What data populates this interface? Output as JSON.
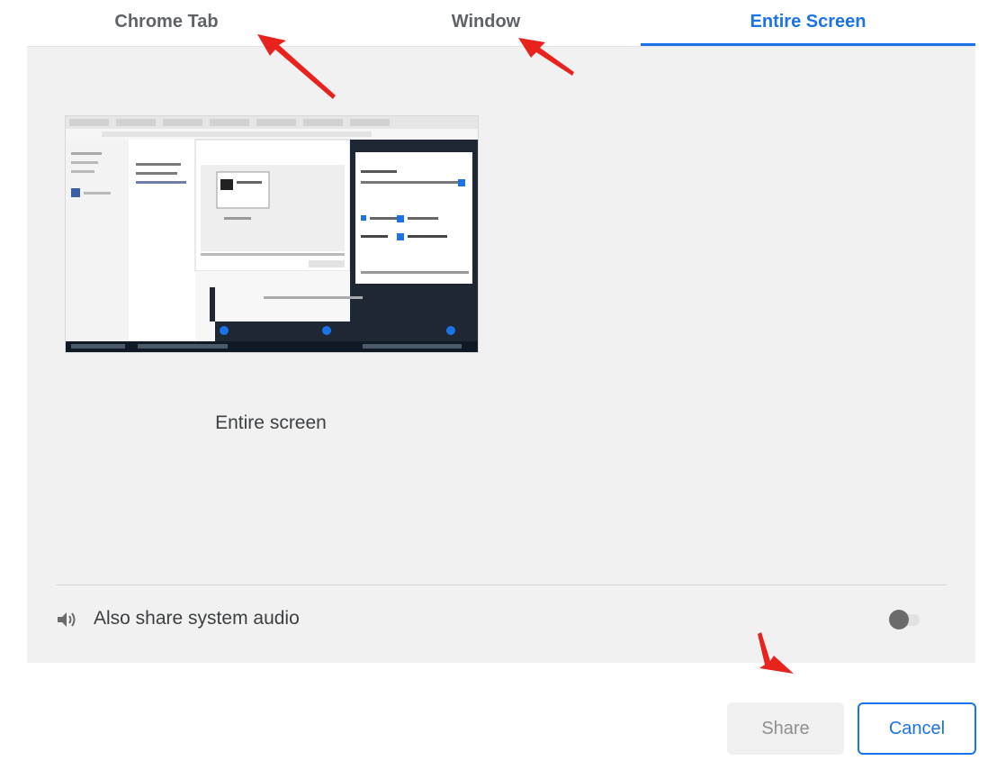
{
  "tabs": {
    "chrome_tab": "Chrome Tab",
    "window": "Window",
    "entire_screen": "Entire Screen",
    "active": "Entire Screen"
  },
  "source": {
    "label": "Entire screen"
  },
  "audio": {
    "label": "Also share system audio",
    "enabled": false
  },
  "buttons": {
    "share": "Share",
    "cancel": "Cancel"
  },
  "icons": {
    "audio": "speaker-icon"
  },
  "colors": {
    "accent": "#1a73e8",
    "annotation": "#e8231d",
    "panel": "#f1f1f1"
  }
}
